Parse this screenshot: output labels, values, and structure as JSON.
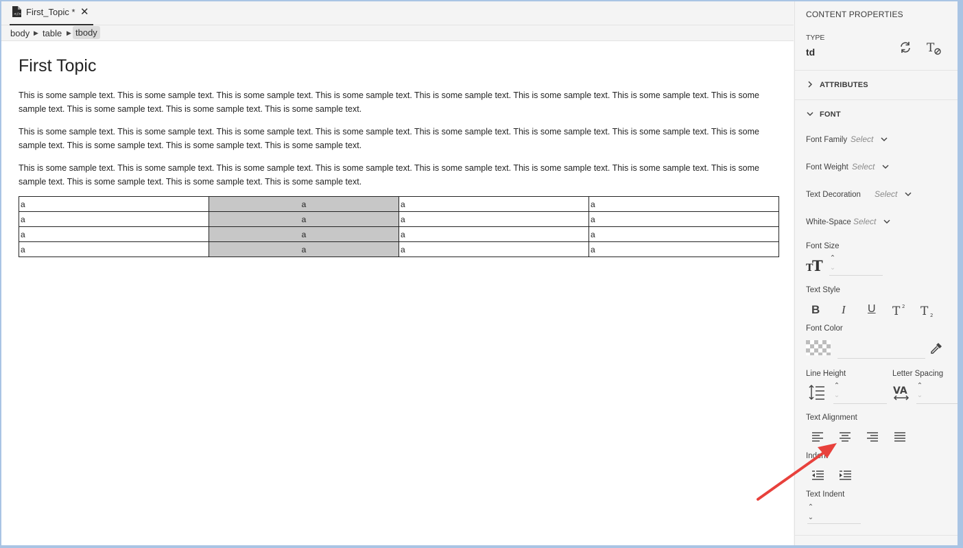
{
  "tab": {
    "title": "First_Topic *"
  },
  "breadcrumb": [
    "body",
    "table",
    "tbody"
  ],
  "document": {
    "title": "First Topic",
    "paragraphs": [
      "This is some sample text. This is some sample text. This is some sample text. This is some sample text. This is some sample text. This is some sample text. This is some sample text. This is some sample text. This is some sample text. This is some sample text. This is some sample text.",
      "This is some sample text. This is some sample text. This is some sample text. This is some sample text. This is some sample text. This is some sample text. This is some sample text. This is some sample text. This is some sample text. This is some sample text. This is some sample text.",
      "This is some sample text. This is some sample text. This is some sample text. This is some sample text. This is some sample text. This is some sample text. This is some sample text. This is some sample text. This is some sample text. This is some sample text. This is some sample text."
    ],
    "table": [
      [
        "a",
        "a",
        "a",
        "a"
      ],
      [
        "a",
        "a",
        "a",
        "a"
      ],
      [
        "a",
        "a",
        "a",
        "a"
      ],
      [
        "a",
        "a",
        "a",
        "a"
      ]
    ]
  },
  "panel": {
    "heading": "CONTENT PROPERTIES",
    "type_label": "TYPE",
    "type_value": "td",
    "attributes_label": "ATTRIBUTES",
    "font_label": "FONT",
    "font_family_label": "Font Family",
    "font_weight_label": "Font Weight",
    "text_decoration_label": "Text Decoration",
    "white_space_label": "White-Space",
    "select_placeholder": "Select",
    "font_size_label": "Font Size",
    "text_style_label": "Text Style",
    "font_color_label": "Font Color",
    "line_height_label": "Line Height",
    "letter_spacing_label": "Letter Spacing",
    "text_alignment_label": "Text Alignment",
    "indent_label": "Indent",
    "text_indent_label": "Text Indent",
    "style_buttons": [
      "B",
      "I",
      "U"
    ]
  },
  "colors": {
    "annotation_arrow": "#e8413c",
    "selected_cell": "#c7c7c7",
    "frame": "#a9c4e4"
  },
  "icons": [
    "doc-icon",
    "close-icon",
    "refresh-icon",
    "clear-format-icon",
    "chevron-right-icon",
    "chevron-down-icon",
    "font-size-icon",
    "bold-icon",
    "italic-icon",
    "underline-icon",
    "superscript-icon",
    "subscript-icon",
    "transparent-swatch-icon",
    "eyedropper-icon",
    "line-height-icon",
    "letter-spacing-icon",
    "align-left-icon",
    "align-center-icon",
    "align-right-icon",
    "align-justify-icon",
    "outdent-icon",
    "indent-icon"
  ]
}
